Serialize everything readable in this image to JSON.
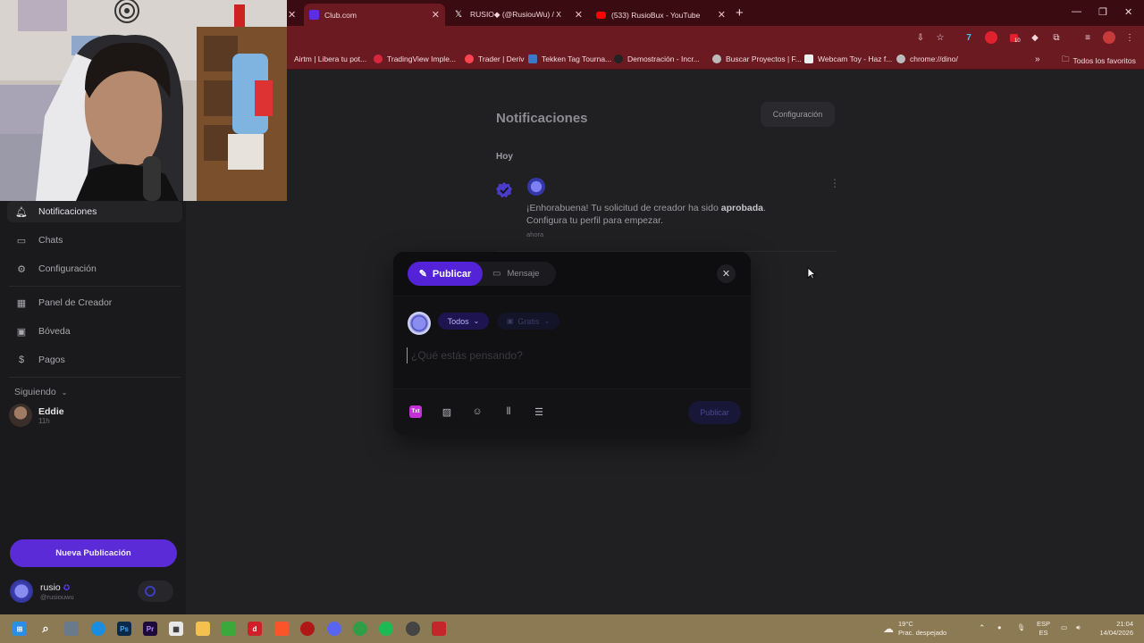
{
  "browser": {
    "tabs": [
      {
        "title": "Club.com",
        "color": "#5b2ee0",
        "active": true
      },
      {
        "title": "RUSIO◆ (@RusiouWu) / X",
        "color": "#222222",
        "active": false
      },
      {
        "title": "(533) RusioBux - YouTube",
        "color": "#ff0000",
        "active": false
      }
    ],
    "bookmarks": [
      {
        "label": "Airtm | Libera tu pot..."
      },
      {
        "label": "TradingView Imple..."
      },
      {
        "label": "Trader | Deriv"
      },
      {
        "label": "Tekken Tag Tourna..."
      },
      {
        "label": "Demostración - Incr..."
      },
      {
        "label": "Buscar Proyectos | F..."
      },
      {
        "label": "Webcam Toy - Haz f..."
      },
      {
        "label": "chrome://dino/"
      }
    ],
    "all_bookmarks": "Todos los favoritos",
    "extension_badge": "10"
  },
  "sidebar": {
    "items": [
      {
        "label": "Notificaciones",
        "icon": "bell-icon",
        "active": true
      },
      {
        "label": "Chats",
        "icon": "chat-icon"
      },
      {
        "label": "Configuración",
        "icon": "gear-icon"
      },
      {
        "label": "Panel de Creador",
        "icon": "dashboard-icon"
      },
      {
        "label": "Bóveda",
        "icon": "vault-icon"
      },
      {
        "label": "Pagos",
        "icon": "dollar-icon"
      }
    ],
    "following_label": "Siguiendo",
    "following": [
      {
        "name": "Eddie",
        "time": "11h"
      }
    ],
    "new_post": "Nueva Publicación",
    "user": {
      "name": "rusio",
      "handle": "@rusiouwu"
    }
  },
  "notifications": {
    "title": "Notificaciones",
    "settings_button": "Configuración",
    "section": "Hoy",
    "items": [
      {
        "text_before": "¡Enhorabuena! Tu solicitud de creador ha sido ",
        "text_bold": "aprobada",
        "text_after": ". Configura tu perfil para empezar.",
        "time": "ahora"
      }
    ]
  },
  "composer": {
    "tab_publish": "Publicar",
    "tab_message": "Mensaje",
    "audience": "Todos",
    "price": "Gratis",
    "placeholder": "¿Qué estás pensando?",
    "text_badge": "Txt",
    "publish_button": "Publicar"
  },
  "taskbar": {
    "weather_temp": "19°C",
    "weather_desc": "Prac. despejado",
    "lang_top": "ESP",
    "lang_bottom": "ES",
    "time": "21:04",
    "date": "14/04/2026",
    "notif_count": "2"
  },
  "colors": {
    "accent": "#5423d8",
    "tabbar": "#3a0c12",
    "toolbar": "#6b1a22"
  }
}
